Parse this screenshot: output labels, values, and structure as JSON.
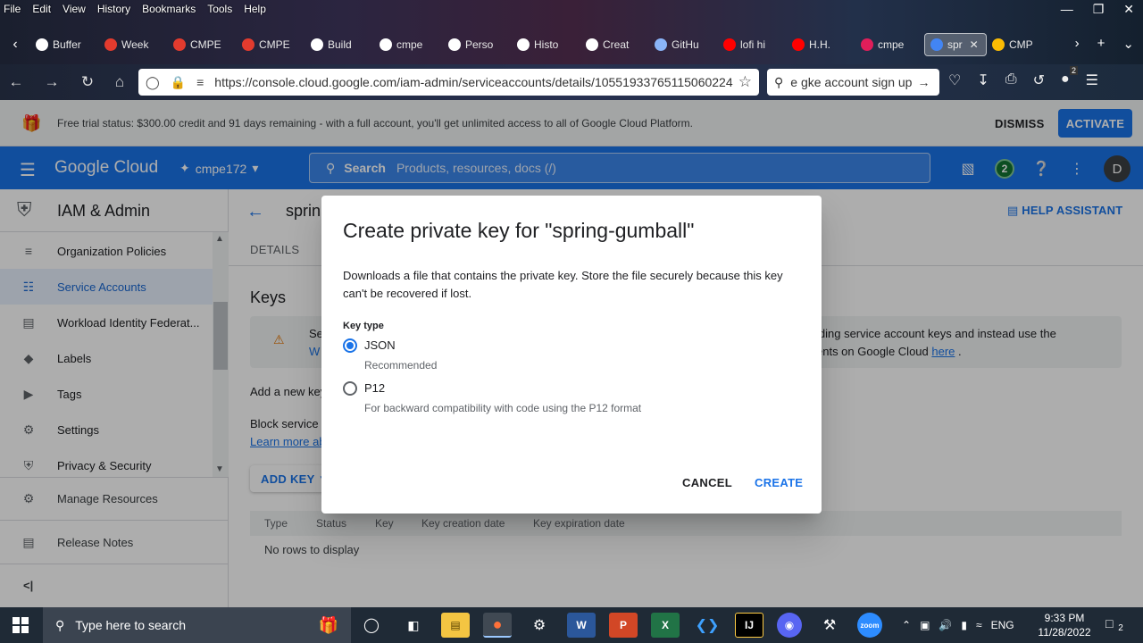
{
  "browser": {
    "menu": [
      "File",
      "Edit",
      "View",
      "History",
      "Bookmarks",
      "Tools",
      "Help"
    ],
    "tabs": [
      {
        "label": "Buffer",
        "color": "#ffffff"
      },
      {
        "label": "Week",
        "color": "#e33b2e"
      },
      {
        "label": "CMPE",
        "color": "#e33b2e"
      },
      {
        "label": "CMPE",
        "color": "#e33b2e"
      },
      {
        "label": "Build",
        "color": "#ffffff"
      },
      {
        "label": "cmpe",
        "color": "#ffffff"
      },
      {
        "label": "Perso",
        "color": "#ffffff"
      },
      {
        "label": "Histo",
        "color": "#ffffff"
      },
      {
        "label": "Creat",
        "color": "#ffffff"
      },
      {
        "label": "GitHu",
        "color": "#8ab4f8"
      },
      {
        "label": "lofi hi",
        "color": "#ff0000"
      },
      {
        "label": "H.H.",
        "color": "#ff0000"
      },
      {
        "label": "cmpe",
        "color": "#e01e5a"
      },
      {
        "label": "spr",
        "color": "#4285f4",
        "active": true
      },
      {
        "label": "CMP",
        "color": "#fbbc04"
      }
    ],
    "url": "https://console.cloud.google.com/iam-admin/serviceaccounts/details/10551933765115060224",
    "search_value": "e gke account sign up",
    "notif_count": "2"
  },
  "trial": {
    "message": "Free trial status: $300.00 credit and 91 days remaining - with a full account, you'll get unlimited access to all of Google Cloud Platform.",
    "dismiss": "DISMISS",
    "activate": "ACTIVATE"
  },
  "header": {
    "logo": "Google Cloud",
    "project": "cmpe172",
    "search_label": "Search",
    "search_placeholder": "Products, resources, docs (/)",
    "notifications": "2",
    "avatar": "D"
  },
  "sidebar": {
    "title": "IAM & Admin",
    "items": [
      {
        "label": "Organization Policies",
        "icon": "list-icon"
      },
      {
        "label": "Service Accounts",
        "icon": "service-account-icon",
        "active": true
      },
      {
        "label": "Workload Identity Federat...",
        "icon": "id-card-icon"
      },
      {
        "label": "Labels",
        "icon": "label-icon"
      },
      {
        "label": "Tags",
        "icon": "tag-icon"
      },
      {
        "label": "Settings",
        "icon": "gear-icon"
      },
      {
        "label": "Privacy & Security",
        "icon": "shield-icon"
      }
    ],
    "manage_resources": "Manage Resources",
    "release_notes": "Release Notes",
    "collapse": "<|"
  },
  "main": {
    "title": "sprin",
    "help_assistant": "HELP ASSISTANT",
    "tab_details": "DETAILS",
    "keys_heading": "Keys",
    "warn_line1_start": "Se",
    "warn_line1_end": "iding service account keys and instead use the",
    "warn_line2_start": "W",
    "warn_line2_end": "ents on Google Cloud",
    "warn_link": "here",
    "add_text": "Add a new key",
    "block_text": "Block service",
    "learn_more": "Learn more ab",
    "add_key": "ADD KEY",
    "table_headers": [
      "Type",
      "Status",
      "Key",
      "Key creation date",
      "Key expiration date"
    ],
    "empty": "No rows to display"
  },
  "dialog": {
    "title": "Create private key for \"spring-gumball\"",
    "description": "Downloads a file that contains the private key. Store the file securely because this key can't be recovered if lost.",
    "key_type_label": "Key type",
    "options": [
      {
        "label": "JSON",
        "sub": "Recommended",
        "checked": true
      },
      {
        "label": "P12",
        "sub": "For backward compatibility with code using the P12 format",
        "checked": false
      }
    ],
    "cancel": "CANCEL",
    "create": "CREATE"
  },
  "taskbar": {
    "search_placeholder": "Type here to search",
    "language": "ENG",
    "time": "9:33 PM",
    "date": "11/28/2022",
    "notif_count": "2"
  }
}
